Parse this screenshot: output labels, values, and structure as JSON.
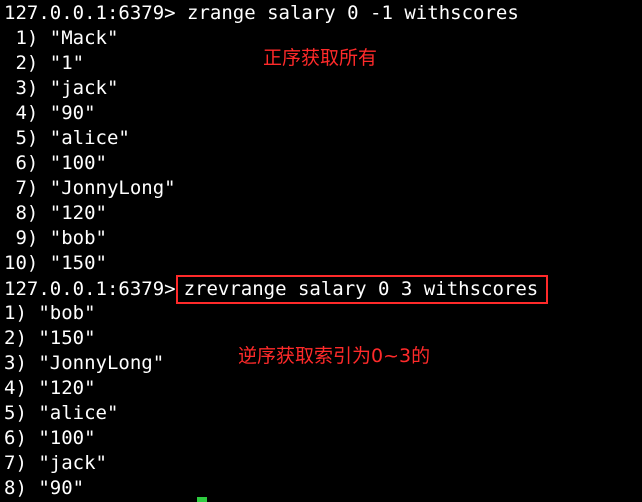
{
  "terminal": {
    "prompt1": "127.0.0.1:6379> ",
    "command1": "zrange salary 0 -1 withscores",
    "output1": [
      " 1) \"Mack\"",
      " 2) \"1\"",
      " 3) \"jack\"",
      " 4) \"90\"",
      " 5) \"alice\"",
      " 6) \"100\"",
      " 7) \"JonnyLong\"",
      " 8) \"120\"",
      " 9) \"bob\"",
      "10) \"150\""
    ],
    "prompt2": "127.0.0.1:6379>",
    "command2": "zrevrange salary 0 3 withscores",
    "output2": [
      "1) \"bob\"",
      "2) \"150\"",
      "3) \"JonnyLong\"",
      "4) \"120\"",
      "5) \"alice\"",
      "6) \"100\"",
      "7) \"jack\"",
      "8) \"90\""
    ]
  },
  "annotations": {
    "note1": "正序获取所有",
    "note2": "逆序获取索引为0~3的"
  },
  "colors": {
    "background": "#000000",
    "text": "#ffffff",
    "annotation": "#ff2a2a",
    "cursor": "#2ecc40"
  }
}
